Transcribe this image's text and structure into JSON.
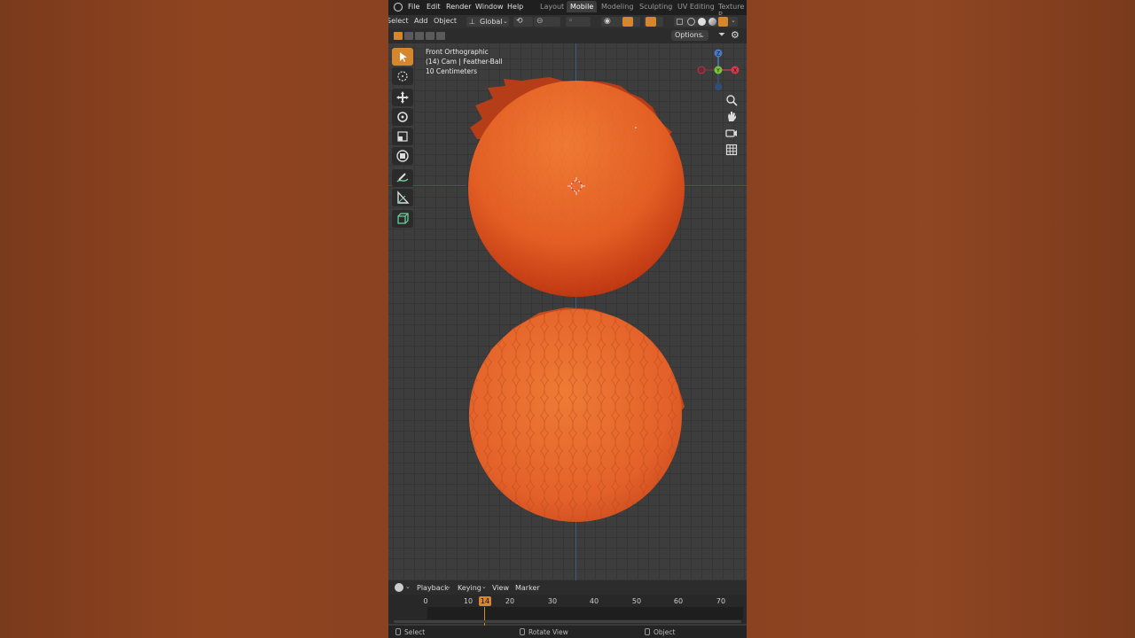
{
  "topbar": {
    "menu": [
      "File",
      "Edit",
      "Render",
      "Window",
      "Help"
    ],
    "workspaces": [
      "Layout",
      "Mobile",
      "Modeling",
      "Sculpting",
      "UV Editing",
      "Texture P"
    ],
    "active_workspace": "Mobile"
  },
  "header": {
    "select_label": "Select",
    "add_label": "Add",
    "object_label": "Object",
    "orientation_label": "Global",
    "options_label": "Options"
  },
  "viewport": {
    "view_name": "Front Orthographic",
    "object_info": "(14) Cam | Feather-Ball",
    "scale_label": "10 Centimeters",
    "gizmo_labels": {
      "z": "Z",
      "y": "Y",
      "x": "X"
    }
  },
  "tools": [
    "select-box",
    "cursor",
    "move",
    "rotate",
    "scale",
    "transform",
    "annotate",
    "measure",
    "add-cube"
  ],
  "timeline": {
    "menu": [
      "Playback",
      "Keying",
      "View",
      "Marker"
    ],
    "ticks": [
      "0",
      "10",
      "20",
      "30",
      "40",
      "50",
      "60",
      "70"
    ],
    "current_frame": "14"
  },
  "statusbar": {
    "select": "Select",
    "rotate_view": "Rotate View",
    "object": "Object"
  },
  "colors": {
    "accent": "#d6862c",
    "sphere_light": "#e8702e",
    "sphere_dark": "#c23a16"
  }
}
